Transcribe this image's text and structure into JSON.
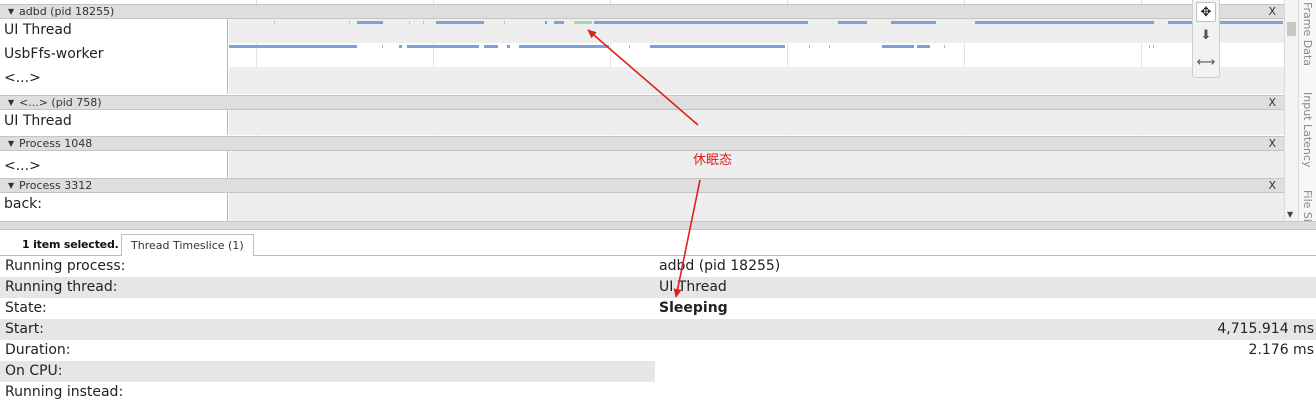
{
  "tracks": {
    "process1": {
      "title": "adbd (pid 18255)",
      "close": "X",
      "threads": [
        "UI Thread",
        "UsbFfs-worker",
        "<...>"
      ]
    },
    "process2": {
      "title": "<...> (pid 758)",
      "close": "X",
      "threads": [
        "UI Thread"
      ]
    },
    "process3": {
      "title": "Process 1048",
      "close": "X",
      "threads": [
        "<...>"
      ]
    },
    "process4": {
      "title": "Process 3312",
      "close": "X",
      "threads": [
        "back:"
      ]
    }
  },
  "side_tabs": [
    "Frame Data",
    "Input Latency",
    "File Si"
  ],
  "toolbox_icons": [
    "move-icon",
    "down-arrow-icon",
    "fit-width-icon"
  ],
  "bottom": {
    "selection_count": "1 item selected.",
    "tab_label": "Thread Timeslice (1)",
    "rows": [
      {
        "key": "Running process:",
        "value": "adbd (pid 18255)"
      },
      {
        "key": "Running thread:",
        "value": "UI Thread"
      },
      {
        "key": "State:",
        "value": "Sleeping"
      },
      {
        "key": "Start:",
        "value": "4,715.914 ms"
      },
      {
        "key": "Duration:",
        "value": "2.176 ms"
      },
      {
        "key": "On CPU:",
        "value": ""
      },
      {
        "key": "Running instead:",
        "value": ""
      }
    ]
  },
  "annotation": {
    "label": "休眠态",
    "color": "#e0201c"
  },
  "colors": {
    "running": "#7da1db",
    "sleeping": "#a8d9a8",
    "header": "#dedede"
  }
}
